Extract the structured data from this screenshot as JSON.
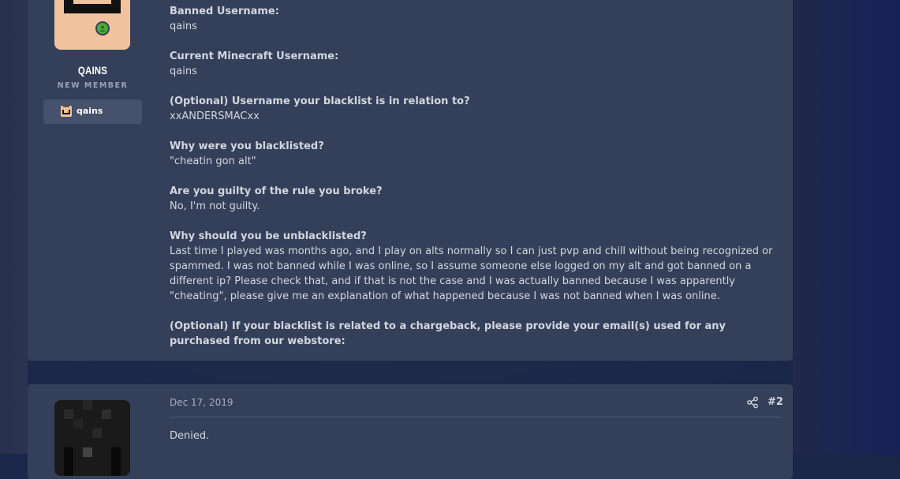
{
  "posts": [
    {
      "author": {
        "name": "QAINS",
        "title": "NEW MEMBER",
        "badge_label": "qains",
        "online": true
      },
      "fields": [
        {
          "question": "Banned Username:",
          "answer": "qains"
        },
        {
          "question": "Current Minecraft Username:",
          "answer": "qains"
        },
        {
          "question": "(Optional) Username your blacklist is in relation to?",
          "answer": "xxANDERSMACxx"
        },
        {
          "question": "Why were you blacklisted?",
          "answer": "\"cheatin gon alt\""
        },
        {
          "question": "Are you guilty of the rule you broke?",
          "answer": "No, I'm not guilty."
        },
        {
          "question": "Why should you be unblacklisted?",
          "answer": "Last time I played was months ago, and I play on alts normally so I can just pvp and chill without being recognized or spammed. I was not banned while I was online, so I assume someone else logged on my alt and got banned on a different ip? Please check that, and if that is not the case and I was actually banned because I was apparently \"cheating\", please give me an explanation of what happened because I was not banned when I was online."
        },
        {
          "question": "(Optional) If your blacklist is related to a chargeback, please provide your email(s) used for any purchased from our webstore:",
          "answer": ""
        }
      ]
    },
    {
      "date": "Dec 17, 2019",
      "number": "#2",
      "share_icon": "share-icon",
      "body": "Denied."
    }
  ],
  "colors": {
    "post_bg": "#34405a",
    "text": "#d2d6de",
    "online": "#4caa3a",
    "badge_bg": "#46516b"
  }
}
